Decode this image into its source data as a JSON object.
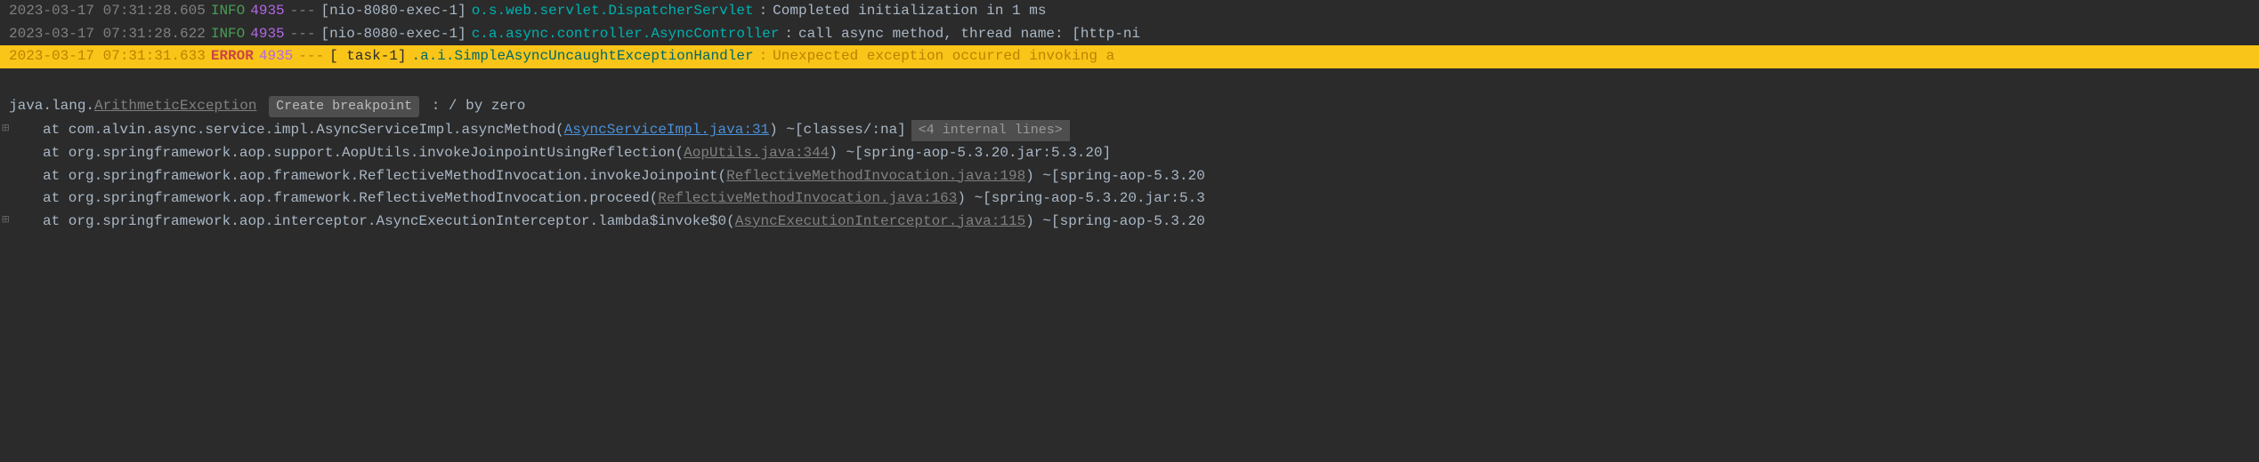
{
  "logs": [
    {
      "timestamp": "2023-03-17 07:31:28.605",
      "level": "INFO",
      "pid": "4935",
      "separator": "---",
      "thread": "[nio-8080-exec-1]",
      "logger": "o.s.web.servlet.DispatcherServlet",
      "message": "Completed initialization in 1 ms",
      "highlighted": false
    },
    {
      "timestamp": "2023-03-17 07:31:28.622",
      "level": "INFO",
      "pid": "4935",
      "separator": "---",
      "thread": "[nio-8080-exec-1]",
      "logger": "c.a.async.controller.AsyncController",
      "message": "call async method, thread name: [http-ni",
      "highlighted": false
    },
    {
      "timestamp": "2023-03-17 07:31:31.633",
      "level": "ERROR",
      "pid": "4935",
      "separator": "---",
      "thread": "[         task-1]",
      "logger": ".a.i.SimpleAsyncUncaughtExceptionHandler",
      "message": "Unexpected exception occurred invoking a",
      "highlighted": true
    }
  ],
  "exception": {
    "package": "java.lang.",
    "class": "ArithmeticException",
    "breakpoint_label": "Create breakpoint",
    "message": " : / by zero"
  },
  "stack": [
    {
      "prefix": "at com.alvin.async.service.impl.AsyncServiceImpl.asyncMethod(",
      "link": "AsyncServiceImpl.java:31",
      "link_active": true,
      "suffix": ") ~[classes/:na]",
      "internal_lines": "<4 internal lines>",
      "gutter": true
    },
    {
      "prefix": "at org.springframework.aop.support.AopUtils.invokeJoinpointUsingReflection(",
      "link": "AopUtils.java:344",
      "link_active": false,
      "suffix": ") ~[spring-aop-5.3.20.jar:5.3.20]",
      "gutter": false
    },
    {
      "prefix": "at org.springframework.aop.framework.ReflectiveMethodInvocation.invokeJoinpoint(",
      "link": "ReflectiveMethodInvocation.java:198",
      "link_active": false,
      "suffix": ") ~[spring-aop-5.3.20",
      "gutter": false
    },
    {
      "prefix": "at org.springframework.aop.framework.ReflectiveMethodInvocation.proceed(",
      "link": "ReflectiveMethodInvocation.java:163",
      "link_active": false,
      "suffix": ") ~[spring-aop-5.3.20.jar:5.3",
      "gutter": false
    },
    {
      "prefix": "at org.springframework.aop.interceptor.AsyncExecutionInterceptor.lambda$invoke$0(",
      "link": "AsyncExecutionInterceptor.java:115",
      "link_active": false,
      "suffix": ") ~[spring-aop-5.3.20",
      "gutter": true
    }
  ]
}
